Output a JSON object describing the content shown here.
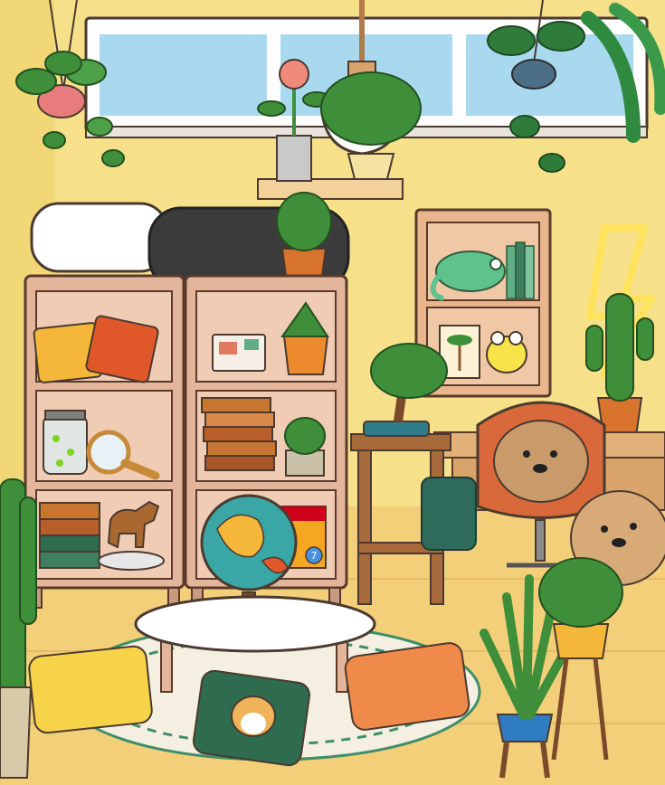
{
  "scene": {
    "room": "living room",
    "palette": {
      "wall": "#f6e08a",
      "floor": "#f3cf7a",
      "window_glass": "#a9d9ef",
      "shelf_wood": "#e3b59b",
      "shelf_outline": "#5a3a2a",
      "plant_green": "#3f8f3a",
      "terracotta": "#d9742e",
      "neon_yellow": "#ffe25c"
    }
  },
  "decor": {
    "postcard_stamp_number": "",
    "book_box_badge": "7"
  },
  "icons": [
    "window",
    "pendant-lamp",
    "hanging-plant",
    "fern",
    "flower-pot",
    "bed-pillows",
    "bookshelf",
    "cushion",
    "jar",
    "magnifying-glass",
    "horse-figurine",
    "postcard",
    "books",
    "succulent",
    "globe",
    "bonsai",
    "wall-shelf",
    "chameleon",
    "frog",
    "palm-painting",
    "lightning-neon",
    "cactus",
    "desk-chair",
    "puppy",
    "backpack",
    "coffee-table",
    "rug",
    "floor-cushion",
    "corgi-cushion",
    "snake-plant",
    "basket"
  ]
}
